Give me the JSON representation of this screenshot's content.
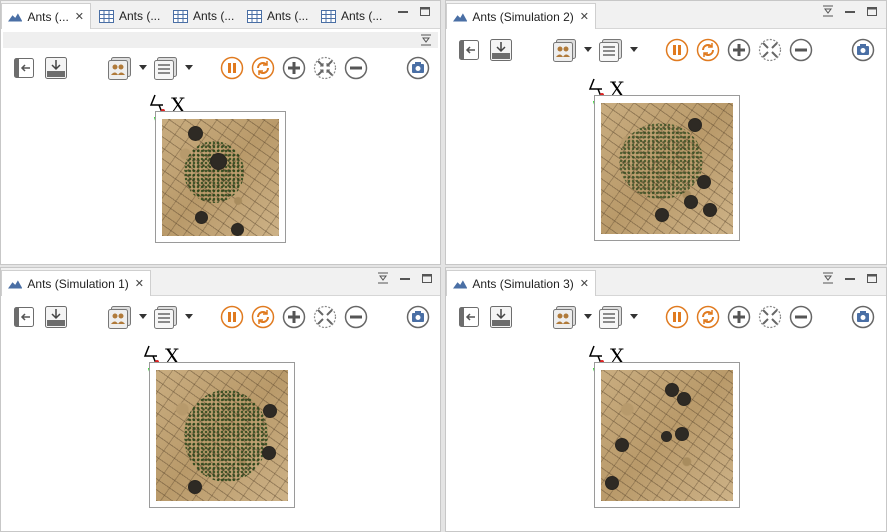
{
  "colors": {
    "accent_orange": "#e07a1f",
    "tab_bg": "#f1f1f1",
    "icon_gray": "#6d6d6d"
  },
  "panes": {
    "top_left": {
      "tabs": [
        {
          "label": "Ants (...",
          "icon": "ants-mountain-icon",
          "active": true,
          "closable": true
        },
        {
          "label": "Ants (...",
          "icon": "table-icon"
        },
        {
          "label": "Ants (...",
          "icon": "table-icon"
        },
        {
          "label": "Ants (...",
          "icon": "table-icon"
        },
        {
          "label": "Ants (...",
          "icon": "table-icon"
        }
      ],
      "axis_label": "X"
    },
    "top_right": {
      "title": "Ants (Simulation 2)",
      "axis_label": "X"
    },
    "bottom_left": {
      "title": "Ants (Simulation 1)",
      "axis_label": "X"
    },
    "bottom_right": {
      "title": "Ants (Simulation 3)",
      "axis_label": "X"
    }
  },
  "toolbar_icons": [
    "toggle-side-panel-icon",
    "export-icon",
    "layers-icon",
    "display-options-icon",
    "pause-icon",
    "reload-icon",
    "zoom-in-icon",
    "zoom-fit-icon",
    "zoom-out-icon",
    "snapshot-icon"
  ]
}
